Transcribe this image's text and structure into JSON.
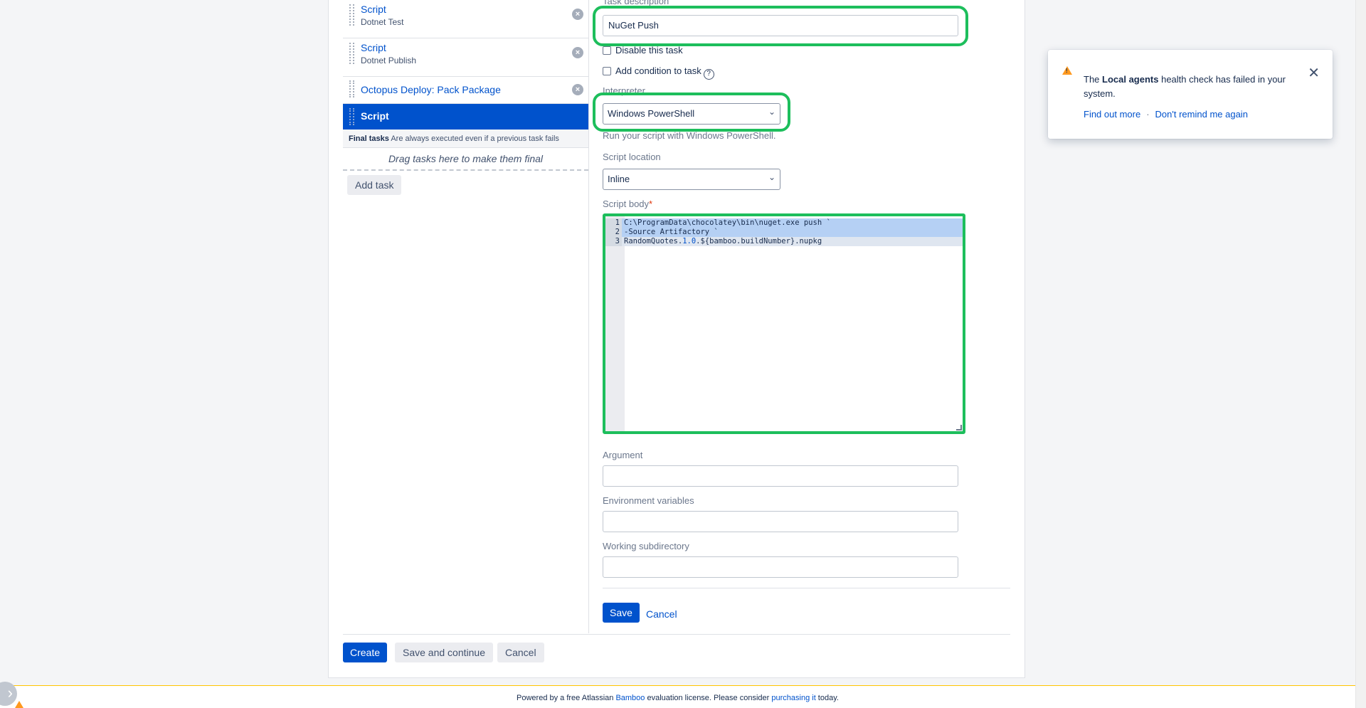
{
  "tasks": [
    {
      "name": "Script",
      "sub": "Dotnet Test"
    },
    {
      "name": "Script",
      "sub": "Dotnet Publish"
    },
    {
      "name": "Octopus Deploy: Pack Package",
      "sub": ""
    }
  ],
  "active_task": {
    "name": "Script"
  },
  "final_tasks": {
    "title": "Final tasks",
    "note": "Are always executed even if a previous task fails",
    "drop_hint": "Drag tasks here to make them final"
  },
  "add_task_label": "Add task",
  "form": {
    "task_description_label": "Task description",
    "task_description_value": "NuGet Push",
    "disable_label": "Disable this task",
    "condition_label": "Add condition to task",
    "help_glyph": "?",
    "interpreter_label": "Interpreter",
    "interpreter_value": "Windows PowerShell",
    "interpreter_hint": "Run your script with Windows PowerShell.",
    "script_location_label": "Script location",
    "script_location_value": "Inline",
    "script_body_label": "Script body",
    "required_mark": "*",
    "code_lines": [
      {
        "n": "1",
        "text": "C:\\ProgramData\\chocolatey\\bin\\nuget.exe push `"
      },
      {
        "n": "2",
        "text": "-Source Artifactory `"
      },
      {
        "n": "3",
        "pre": "RandomQuotes.",
        "num": "1.0",
        "post": ".${bamboo.buildNumber}.nupkg"
      }
    ],
    "argument_label": "Argument",
    "env_label": "Environment variables",
    "working_dir_label": "Working subdirectory",
    "save_label": "Save",
    "cancel_label": "Cancel"
  },
  "bottom_actions": {
    "create": "Create",
    "save_continue": "Save and continue",
    "cancel": "Cancel"
  },
  "flag": {
    "pre": "The ",
    "bold": "Local agents",
    "post": " health check has failed in your system.",
    "find_out_more": "Find out more",
    "separator": "·",
    "dont_remind": "Don't remind me again",
    "close_glyph": "✕"
  },
  "footer": {
    "pre": "Powered by a free Atlassian ",
    "bamboo": "Bamboo",
    "mid": " evaluation license. Please consider ",
    "purchasing": "purchasing it",
    "post": " today."
  },
  "colors": {
    "accent": "#0052cc",
    "highlight": "#1dbe5c",
    "warning": "#ff991f"
  }
}
